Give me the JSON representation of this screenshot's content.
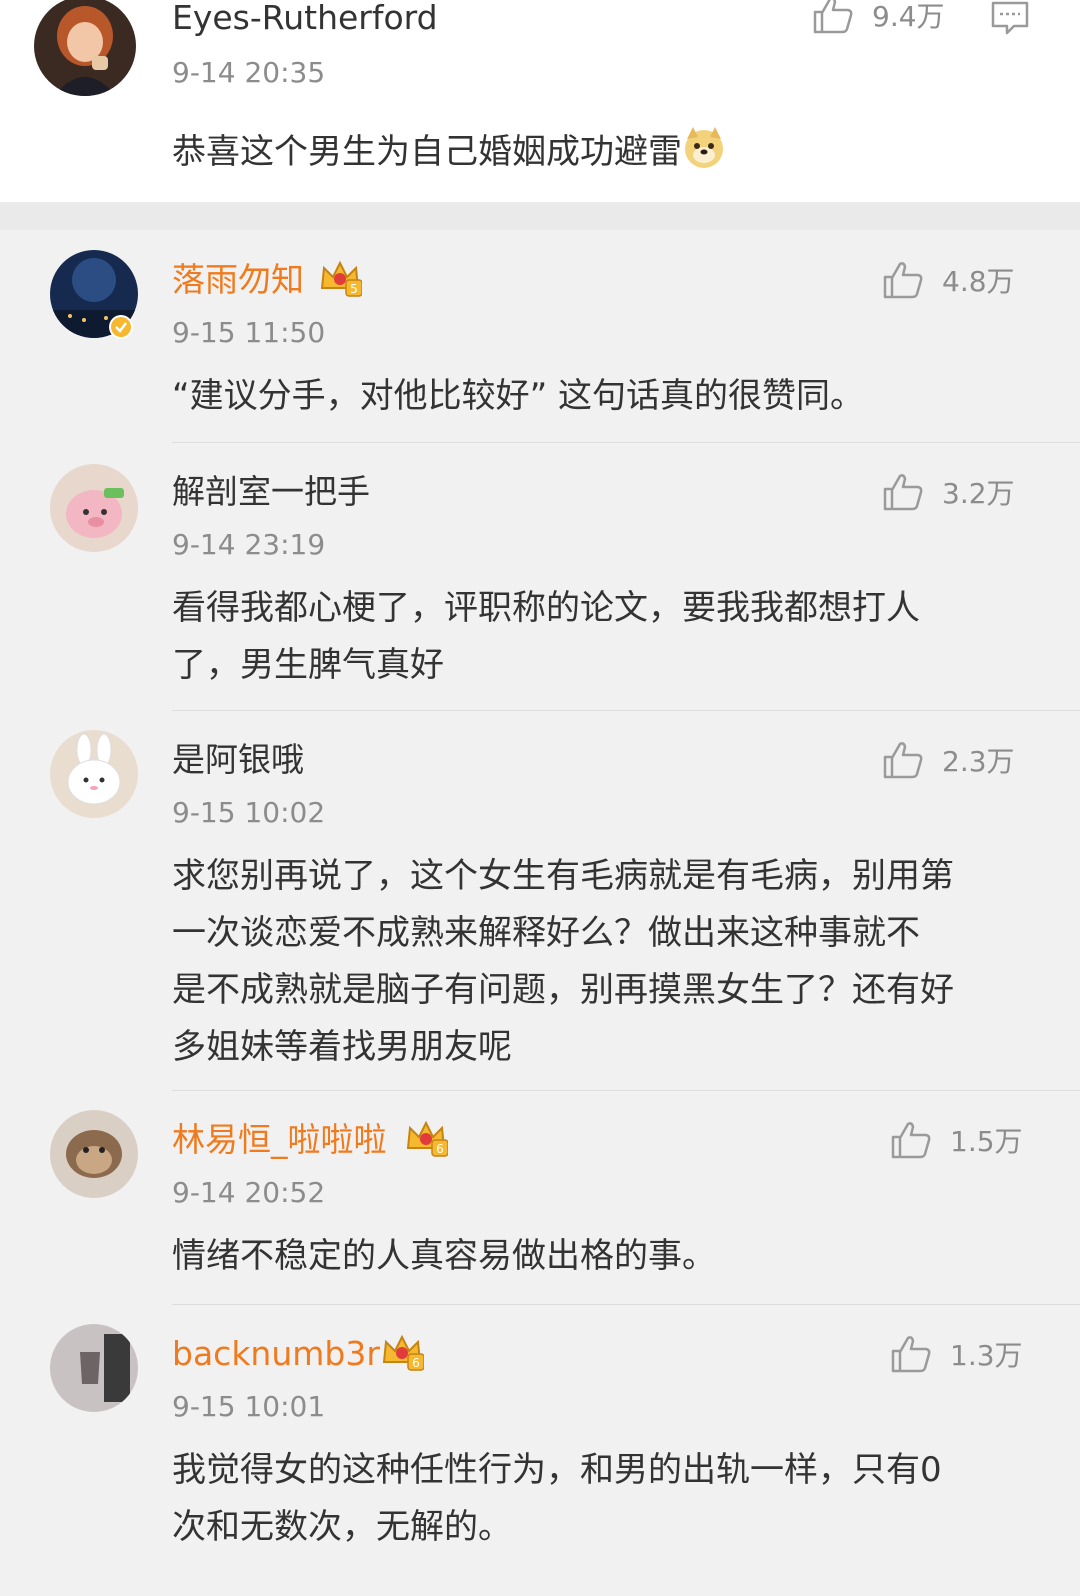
{
  "top_comment": {
    "author": "Eyes-Rutherford",
    "time": "9-14 20:35",
    "likes": "9.4万",
    "text": "恭喜这个男生为自己婚姻成功避雷",
    "emoji_icon": "doge-emoji-icon"
  },
  "comments": [
    {
      "author": "落雨勿知",
      "badge_level": "5",
      "time": "9-15 11:50",
      "likes": "4.8万",
      "text_lines": [
        "“建议分手，对他比较好” 这句话真的很赞同。"
      ]
    },
    {
      "author": "解剖室一把手",
      "time": "9-14 23:19",
      "likes": "3.2万",
      "text_lines": [
        "看得我都心梗了，评职称的论文，要我我都想打人",
        "了，男生脾气真好"
      ]
    },
    {
      "author": "是阿银哦",
      "time": "9-15 10:02",
      "likes": "2.3万",
      "text_lines": [
        "求您别再说了，这个女生有毛病就是有毛病，别用第",
        "一次谈恋爱不成熟来解释好么？做出来这种事就不",
        "是不成熟就是脑子有问题，别再摸黑女生了？还有好",
        "多姐妹等着找男朋友呢"
      ]
    },
    {
      "author": "林易恒_啦啦啦",
      "badge_level": "6",
      "time": "9-14 20:52",
      "likes": "1.5万",
      "text_lines": [
        "情绪不稳定的人真容易做出格的事。"
      ]
    },
    {
      "author": "backnumb3r",
      "badge_level": "6",
      "time": "9-15 10:01",
      "likes": "1.3万",
      "text_lines": [
        "我觉得女的这种任性行为，和男的出轨一样，只有0",
        "次和无数次，无解的。"
      ]
    }
  ],
  "colors": {
    "vip_name": "#f07a1e",
    "crown_gold": "#f5b82e",
    "verified_badge": "#f5b82e",
    "meta_gray": "#8c8c8c"
  }
}
